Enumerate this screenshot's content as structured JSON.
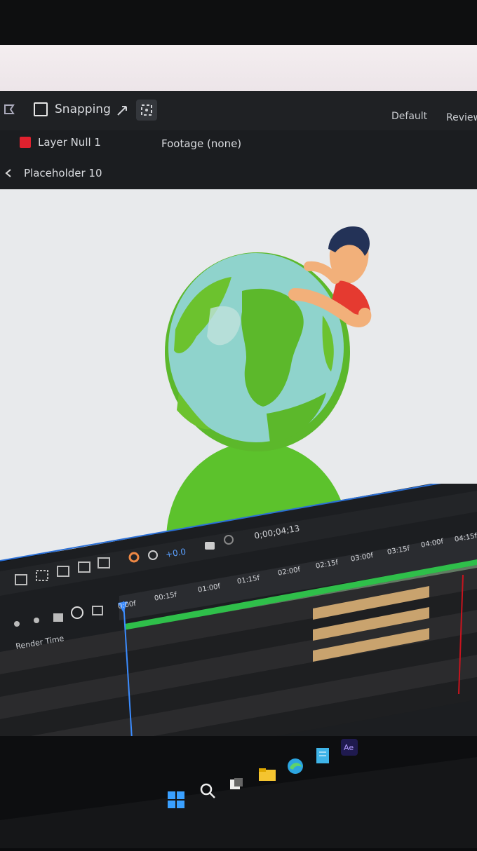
{
  "toolbar": {
    "snapping_label": "Snapping",
    "workspace_default": "Default",
    "workspace_review": "Review"
  },
  "info_bar": {
    "layer_label": "Layer Null 1",
    "footage_label": "Footage (none)"
  },
  "composition_bar": {
    "comp_name": "Placeholder 10"
  },
  "timeline": {
    "timecode": "0;00;04;13",
    "exposure": "+0.0",
    "render_time_label": "Render Time",
    "ruler_labels": [
      "0:00f",
      "00:15f",
      "01:00f",
      "01:15f",
      "02:00f",
      "02:15f",
      "03:00f",
      "03:15f",
      "04:00f",
      "04:15f"
    ]
  },
  "colors": {
    "layer_color": "#e0212e",
    "workarea": "#2fbf4a",
    "layer_bar_tan": "#c9a36e",
    "playhead": "#3b8cff",
    "end_marker": "#c8141e"
  },
  "icons": [
    "snapping-checkbox",
    "selection-tool-icon",
    "anchor-tool-icon",
    "back-chevron-icon",
    "camera-icon",
    "color-wheel-icon",
    "refresh-icon",
    "windows-start-icon",
    "search-icon",
    "after-effects-icon"
  ]
}
